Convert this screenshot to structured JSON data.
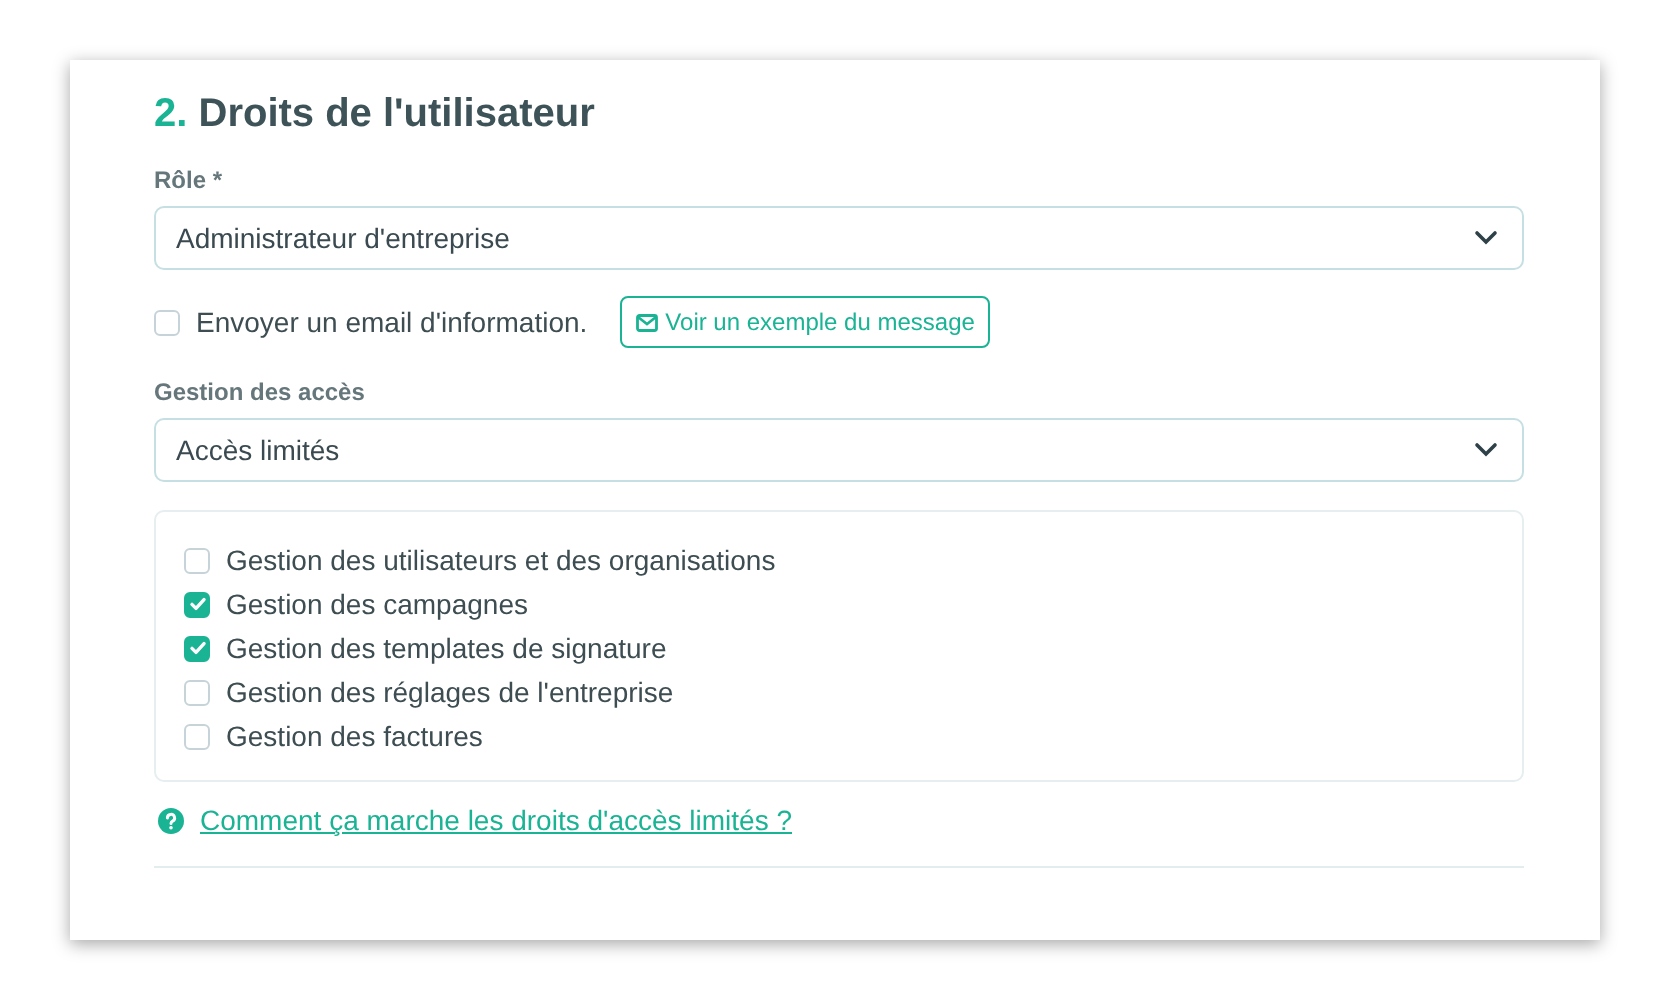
{
  "section": {
    "number": "2.",
    "title": "Droits de l'utilisateur"
  },
  "role": {
    "label": "Rôle *",
    "value": "Administrateur d'entreprise"
  },
  "notify": {
    "label": "Envoyer un email d'information.",
    "checked": false,
    "button": "Voir un exemple du message"
  },
  "access": {
    "label": "Gestion des accès",
    "value": "Accès limités"
  },
  "permissions": [
    {
      "label": "Gestion des utilisateurs et des organisations",
      "checked": false
    },
    {
      "label": "Gestion des campagnes",
      "checked": true
    },
    {
      "label": "Gestion des templates de signature",
      "checked": true
    },
    {
      "label": "Gestion des réglages de l'entreprise",
      "checked": false
    },
    {
      "label": "Gestion des factures",
      "checked": false
    }
  ],
  "help_link": "Comment ça marche les droits d'accès limités ?"
}
